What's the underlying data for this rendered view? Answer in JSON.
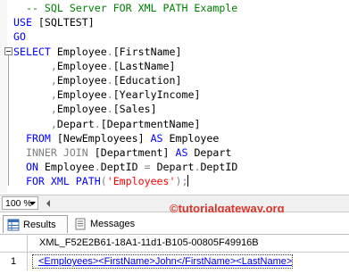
{
  "editor": {
    "lines": [
      [
        {
          "t": "  -- SQL Server FOR XML PATH Example",
          "c": "cm"
        }
      ],
      [
        {
          "t": "USE ",
          "c": "kw"
        },
        {
          "t": "[SQLTEST]",
          "c": "tx"
        }
      ],
      [
        {
          "t": "GO",
          "c": "kw"
        }
      ],
      [
        {
          "t": "SELECT ",
          "c": "kw"
        },
        {
          "t": "Employee",
          "c": "tx"
        },
        {
          "t": ".",
          "c": "gr"
        },
        {
          "t": "[FirstName]",
          "c": "tx"
        }
      ],
      [
        {
          "t": "      ",
          "c": "tx"
        },
        {
          "t": ",",
          "c": "gr"
        },
        {
          "t": "Employee",
          "c": "tx"
        },
        {
          "t": ".",
          "c": "gr"
        },
        {
          "t": "[LastName]",
          "c": "tx"
        }
      ],
      [
        {
          "t": "      ",
          "c": "tx"
        },
        {
          "t": ",",
          "c": "gr"
        },
        {
          "t": "Employee",
          "c": "tx"
        },
        {
          "t": ".",
          "c": "gr"
        },
        {
          "t": "[Education]",
          "c": "tx"
        }
      ],
      [
        {
          "t": "      ",
          "c": "tx"
        },
        {
          "t": ",",
          "c": "gr"
        },
        {
          "t": "Employee",
          "c": "tx"
        },
        {
          "t": ".",
          "c": "gr"
        },
        {
          "t": "[YearlyIncome]",
          "c": "tx"
        }
      ],
      [
        {
          "t": "      ",
          "c": "tx"
        },
        {
          "t": ",",
          "c": "gr"
        },
        {
          "t": "Employee",
          "c": "tx"
        },
        {
          "t": ".",
          "c": "gr"
        },
        {
          "t": "[Sales]",
          "c": "tx"
        }
      ],
      [
        {
          "t": "      ",
          "c": "tx"
        },
        {
          "t": ",",
          "c": "gr"
        },
        {
          "t": "Depart",
          "c": "tx"
        },
        {
          "t": ".",
          "c": "gr"
        },
        {
          "t": "[DepartmentName]",
          "c": "tx"
        }
      ],
      [
        {
          "t": "  FROM ",
          "c": "kw"
        },
        {
          "t": "[NewEmployees] ",
          "c": "tx"
        },
        {
          "t": "AS ",
          "c": "kw"
        },
        {
          "t": "Employee",
          "c": "tx"
        }
      ],
      [
        {
          "t": "  INNER JOIN ",
          "c": "gr"
        },
        {
          "t": "[Department] ",
          "c": "tx"
        },
        {
          "t": "AS ",
          "c": "kw"
        },
        {
          "t": "Depart",
          "c": "tx"
        }
      ],
      [
        {
          "t": "  ON ",
          "c": "kw"
        },
        {
          "t": "Employee",
          "c": "tx"
        },
        {
          "t": ".",
          "c": "gr"
        },
        {
          "t": "DeptID ",
          "c": "tx"
        },
        {
          "t": "= ",
          "c": "gr"
        },
        {
          "t": "Depart",
          "c": "tx"
        },
        {
          "t": ".",
          "c": "gr"
        },
        {
          "t": "DeptID",
          "c": "tx"
        }
      ],
      [
        {
          "t": "  FOR XML PATH",
          "c": "kw"
        },
        {
          "t": "(",
          "c": "gr"
        },
        {
          "t": "'Employees'",
          "c": "st"
        },
        {
          "t": ");",
          "c": "gr"
        }
      ]
    ]
  },
  "zoom": {
    "value": "100 %"
  },
  "watermark": "©tutorialgateway.org",
  "tabs": {
    "results": "Results",
    "messages": "Messages"
  },
  "grid": {
    "column_header": "XML_F52E2B61-18A1-11d1-B105-00805F49916B",
    "row_number": "1",
    "cell_value": "<Employees><FirstName>John</FirstName><LastName>..."
  }
}
